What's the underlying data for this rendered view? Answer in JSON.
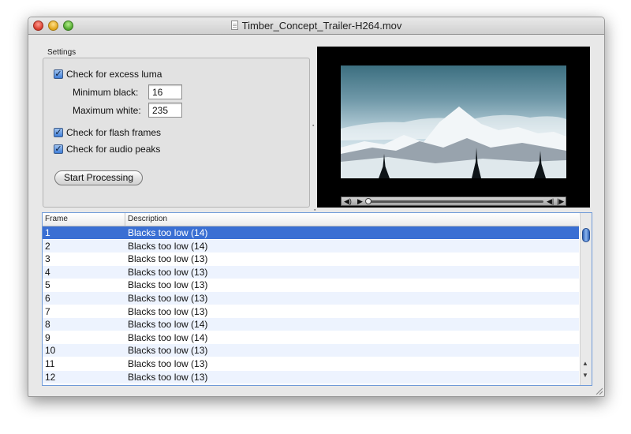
{
  "window": {
    "title": "Timber_Concept_Trailer-H264.mov"
  },
  "settings": {
    "label": "Settings",
    "excess_luma_label": "Check for excess luma",
    "min_black_label": "Minimum black:",
    "min_black_value": "16",
    "max_white_label": "Maximum white:",
    "max_white_value": "235",
    "flash_frames_label": "Check for flash frames",
    "audio_peaks_label": "Check for audio peaks",
    "start_button": "Start Processing",
    "checked": {
      "excess_luma": true,
      "flash_frames": true,
      "audio_peaks": true
    }
  },
  "table": {
    "columns": [
      "Frame",
      "Description"
    ],
    "selected_row": 0,
    "rows": [
      {
        "frame": "1",
        "description": "Blacks too low (14)"
      },
      {
        "frame": "2",
        "description": "Blacks too low (14)"
      },
      {
        "frame": "3",
        "description": "Blacks too low (13)"
      },
      {
        "frame": "4",
        "description": "Blacks too low (13)"
      },
      {
        "frame": "5",
        "description": "Blacks too low (13)"
      },
      {
        "frame": "6",
        "description": "Blacks too low (13)"
      },
      {
        "frame": "7",
        "description": "Blacks too low (13)"
      },
      {
        "frame": "8",
        "description": "Blacks too low (14)"
      },
      {
        "frame": "9",
        "description": "Blacks too low (14)"
      },
      {
        "frame": "10",
        "description": "Blacks too low (13)"
      },
      {
        "frame": "11",
        "description": "Blacks too low (13)"
      },
      {
        "frame": "12",
        "description": "Blacks too low (13)"
      }
    ]
  },
  "player": {
    "playhead_position": 0.0
  },
  "colors": {
    "selection": "#3a6fd3",
    "alternate_row": "#edf3fe",
    "video_background": "#000000"
  },
  "icons": [
    "close-light-icon",
    "minimize-light-icon",
    "zoom-light-icon",
    "document-icon",
    "checkmark-icon",
    "volume-icon",
    "play-icon",
    "step-back-icon",
    "step-forward-icon",
    "scroll-up-arrow-icon",
    "scroll-down-arrow-icon",
    "resize-grip-icon"
  ]
}
